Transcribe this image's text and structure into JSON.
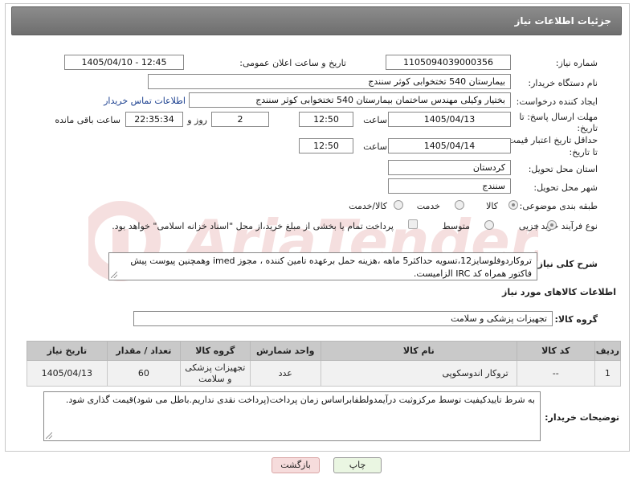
{
  "page_title": "جزئیات اطلاعات نیاز",
  "fields": {
    "need_number_label": "شماره نیاز:",
    "need_number": "1105094039000356",
    "announce_label": "تاریخ و ساعت اعلان عمومی:",
    "announce_value": "1405/04/10 - 12:45",
    "buyer_org_label": "نام دستگاه خریدار:",
    "buyer_org": "بیمارستان 540 تختخوابی کوثر سنندج",
    "creator_label": "ایجاد کننده درخواست:",
    "creator": "بختیار وکیلی مهندس ساختمان بیمارستان 540 تختخوابی کوثر سنندج",
    "contact_link": "اطلاعات تماس خریدار",
    "deadline_label_1": "مهلت ارسال پاسخ: تا",
    "deadline_label_2": "تاریخ:",
    "deadline_date": "1405/04/13",
    "time_label": "ساعت",
    "deadline_time": "12:50",
    "days_value": "2",
    "days_label": "روز و",
    "remaining_value": "22:35:34",
    "remaining_label": "ساعت باقی مانده",
    "price_valid_label_1": "حداقل تاریخ اعتبار قیمت:",
    "price_valid_label_2": "تا تاریخ:",
    "price_valid_date": "1405/04/14",
    "price_valid_time": "12:50",
    "province_label": "استان محل تحویل:",
    "province": "کردستان",
    "city_label": "شهر محل تحویل:",
    "city": "سنندج",
    "category_label": "طبقه بندی موضوعی:",
    "category_options": [
      "کالا",
      "خدمت",
      "کالا/خدمت"
    ],
    "process_label": "نوع فرآیند خرید :",
    "process_options": [
      "جزیی",
      "متوسط"
    ],
    "payment_note": "پرداخت تمام یا بخشی از مبلغ خرید،از محل \"اسناد خزانه اسلامی\" خواهد بود."
  },
  "description": {
    "label": "شرح کلی نیاز:",
    "text": "تروکاردوفلوسایز12،تسویه حداکثر5 ماهه ،هزینه حمل برعهده تامین کننده ، مجوز imed وهمچنین پیوست پیش فاکتور همراه کد IRC الزامیست."
  },
  "goods_info_title": "اطلاعات کالاهای مورد نیاز",
  "goods_group_label": "گروه کالا:",
  "goods_group": "تجهیزات پزشکی و سلامت",
  "table": {
    "headers": [
      "ردیف",
      "کد کالا",
      "نام کالا",
      "واحد شمارش",
      "گروه کالا",
      "تعداد / مقدار",
      "تاریخ نیاز"
    ],
    "rows": [
      [
        "1",
        "--",
        "تروکار اندوسکوپی",
        "عدد",
        "تجهیزات پزشکی و سلامت",
        "60",
        "1405/04/13"
      ]
    ]
  },
  "buyer_notes": {
    "label": "توضیحات خریدار:",
    "text": "به شرط تاییدکیفیت توسط مرکزوثبت درآیمدولطفابراساس زمان پرداخت(پرداخت نقدی نداریم.باطل می شود)قیمت گذاری شود."
  },
  "buttons": {
    "print": "چاپ",
    "back": "بازگشت"
  },
  "watermark_text": "AriaTender.net",
  "colors": {
    "title_bg": "#7a7a7a",
    "link": "#1a3f8f",
    "back_btn_bg": "#f6dcdc",
    "print_btn_bg": "#e8f5e0"
  }
}
